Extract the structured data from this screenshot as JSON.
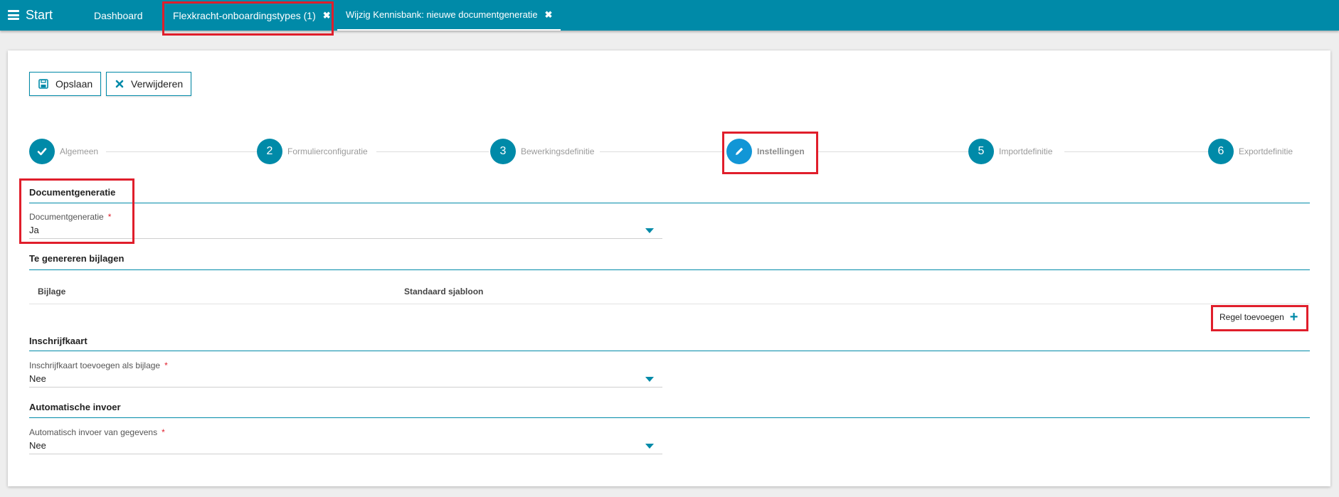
{
  "topbar": {
    "start_label": "Start",
    "tabs": [
      {
        "label": "Dashboard"
      },
      {
        "label": "Flexkracht-onboardingstypes (1)",
        "close": "✖"
      },
      {
        "label": "Wijzig Kennisbank: nieuwe documentgeneratie",
        "close": "✖"
      }
    ]
  },
  "toolbar": {
    "save_label": "Opslaan",
    "delete_label": "Verwijderen"
  },
  "stepper": {
    "steps": [
      {
        "number": "",
        "label": "Algemeen",
        "state": "done"
      },
      {
        "number": "2",
        "label": "Formulierconfiguratie"
      },
      {
        "number": "3",
        "label": "Bewerkingsdefinitie"
      },
      {
        "number": "",
        "label": "Instellingen",
        "state": "active"
      },
      {
        "number": "5",
        "label": "Importdefinitie"
      },
      {
        "number": "6",
        "label": "Exportdefinitie"
      }
    ]
  },
  "sections": {
    "documentgeneratie": {
      "title": "Documentgeneratie",
      "field_label": "Documentgeneratie",
      "required_mark": "*",
      "value": "Ja"
    },
    "bijlagen": {
      "title": "Te genereren bijlagen",
      "columns": [
        "Bijlage",
        "Standaard sjabloon"
      ],
      "add_label": "Regel toevoegen",
      "add_icon": "+"
    },
    "inschrijfkaart": {
      "title": "Inschrijfkaart",
      "field_label": "Inschrijfkaart toevoegen als bijlage",
      "required_mark": "*",
      "value": "Nee"
    },
    "automatisch": {
      "title": "Automatische invoer",
      "field_label": "Automatisch invoer van gegevens",
      "required_mark": "*",
      "value": "Nee"
    }
  },
  "colors": {
    "accent": "#008aa8",
    "active_step": "#1296d6",
    "highlight": "#e01e2b"
  }
}
